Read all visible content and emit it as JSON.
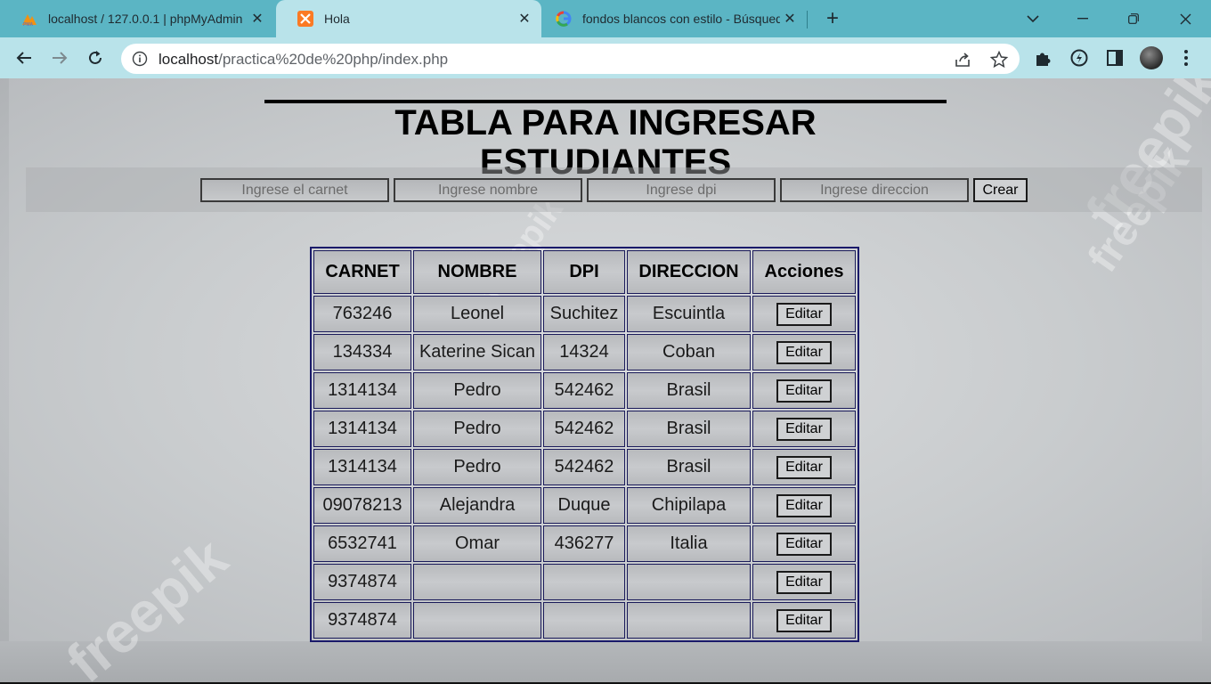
{
  "browser": {
    "tabs": [
      {
        "title": "localhost / 127.0.0.1 | phpMyAdmin",
        "icon": "phpmyadmin-icon"
      },
      {
        "title": "Hola",
        "icon": "xampp-icon"
      },
      {
        "title": "fondos blancos con estilo - Búsqueda",
        "icon": "google-icon"
      }
    ],
    "new_tab_label": "+",
    "url_host": "localhost",
    "url_path": "/practica%20de%20php/index.php"
  },
  "page": {
    "title": "TABLA PARA INGRESAR ESTUDIANTES",
    "watermark": "freepik",
    "form": {
      "carnet_placeholder": "Ingrese el carnet",
      "nombre_placeholder": "Ingrese nombre",
      "dpi_placeholder": "Ingrese dpi",
      "direccion_placeholder": "Ingrese direccion",
      "submit_label": "Crear"
    },
    "table": {
      "headers": [
        "CARNET",
        "NOMBRE",
        "DPI",
        "DIRECCION",
        "Acciones"
      ],
      "edit_label": "Editar",
      "rows": [
        [
          "763246",
          "Leonel",
          "Suchitez",
          "Escuintla"
        ],
        [
          "134334",
          "Katerine Sican",
          "14324",
          "Coban"
        ],
        [
          "1314134",
          "Pedro",
          "542462",
          "Brasil"
        ],
        [
          "1314134",
          "Pedro",
          "542462",
          "Brasil"
        ],
        [
          "1314134",
          "Pedro",
          "542462",
          "Brasil"
        ],
        [
          "09078213",
          "Alejandra",
          "Duque",
          "Chipilapa"
        ],
        [
          "6532741",
          "Omar",
          "436277",
          "Italia"
        ],
        [
          "9374874",
          "",
          "",
          ""
        ],
        [
          "9374874",
          "",
          "",
          ""
        ]
      ]
    }
  },
  "colors": {
    "tabbar": "#5bb5c4",
    "toolbar": "#b9e3ea"
  }
}
